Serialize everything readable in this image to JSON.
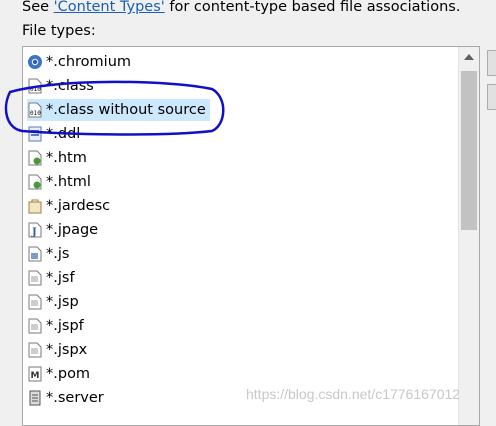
{
  "hint": {
    "prefix": "See ",
    "link": "'Content Types'",
    "suffix": " for content-type based file associations."
  },
  "file_types_label": "File types:",
  "file_types": [
    {
      "label": "*.chromium",
      "icon": "chromium-icon"
    },
    {
      "label": "*.class",
      "icon": "class-file-icon"
    },
    {
      "label": "*.class without source",
      "icon": "class-file-icon",
      "selected": true
    },
    {
      "label": "*.ddl",
      "icon": "database-file-icon"
    },
    {
      "label": "*.htm",
      "icon": "html-file-icon"
    },
    {
      "label": "*.html",
      "icon": "html-file-icon"
    },
    {
      "label": "*.jardesc",
      "icon": "jar-description-icon"
    },
    {
      "label": "*.jpage",
      "icon": "java-page-icon"
    },
    {
      "label": "*.js",
      "icon": "javascript-file-icon"
    },
    {
      "label": "*.jsf",
      "icon": "text-file-icon"
    },
    {
      "label": "*.jsp",
      "icon": "text-file-icon"
    },
    {
      "label": "*.jspf",
      "icon": "text-file-icon"
    },
    {
      "label": "*.jspx",
      "icon": "text-file-icon"
    },
    {
      "label": "*.pom",
      "icon": "maven-pom-icon"
    },
    {
      "label": "*.server",
      "icon": "server-file-icon"
    }
  ],
  "watermark": "https://blog.csdn.net/c1776167012",
  "colors": {
    "selection": "#cce8ff",
    "annotation": "#1010c8",
    "link": "#1a5fb4"
  }
}
